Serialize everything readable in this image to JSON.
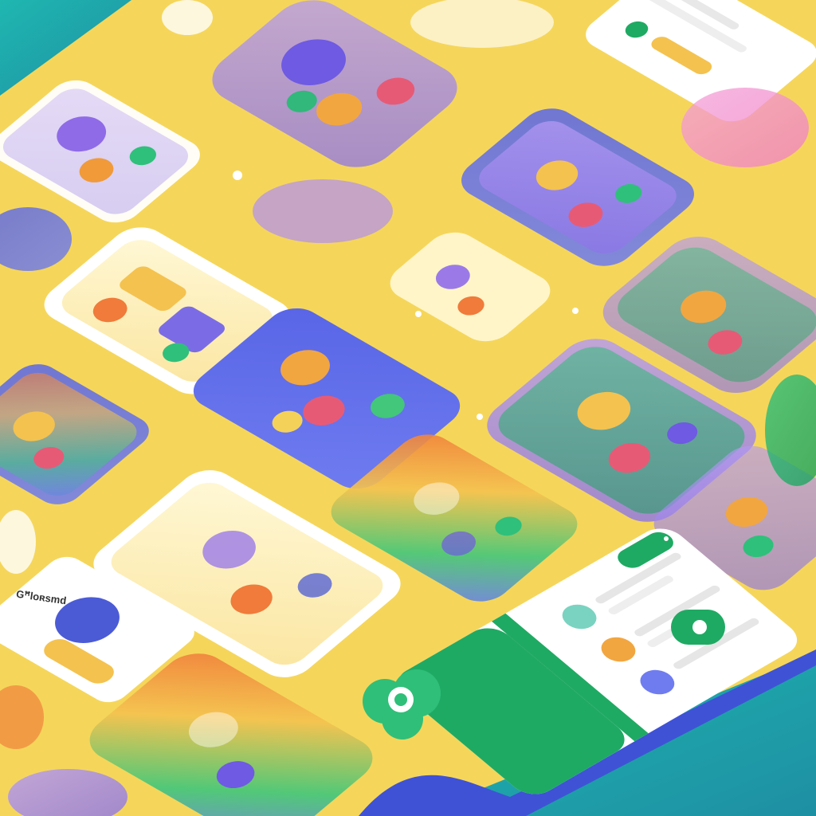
{
  "scene": {
    "description_visible_text": "",
    "card_caption": "Gꟸloʀsmd"
  },
  "palette": {
    "background": "#f5d65a",
    "teal": "#1fa7a4",
    "blue": "#4b5bd6",
    "green": "#1faa63",
    "purple": "#9b7ae8",
    "pink": "#f18ac9",
    "white": "#ffffff",
    "orange": "#f29a3a"
  },
  "icons": [
    "isometric-toy-scene-icon",
    "leaf-logo-icon",
    "sparkle-icon",
    "toggle-button-icon"
  ]
}
